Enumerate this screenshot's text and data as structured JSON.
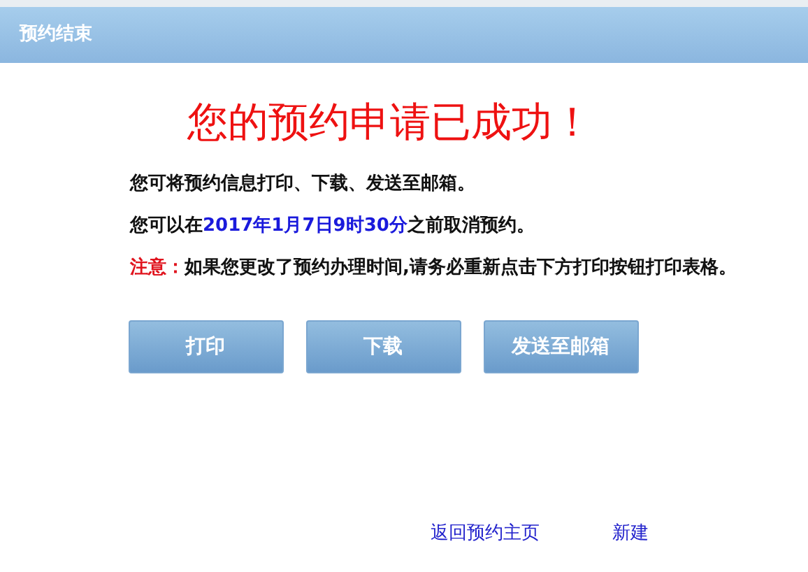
{
  "window": {
    "title": "预约结束"
  },
  "headline": "您的预约申请已成功！",
  "paragraphs": [
    {
      "parts": [
        {
          "kind": "plain",
          "text": "您可将预约信息打印、下载、发送至邮箱。"
        }
      ]
    },
    {
      "parts": [
        {
          "kind": "plain",
          "text": "您可以在"
        },
        {
          "kind": "highlight",
          "text": "2017年1月7日9时30分"
        },
        {
          "kind": "plain",
          "text": "之前取消预约。"
        }
      ]
    },
    {
      "parts": [
        {
          "kind": "warning",
          "text": "注意："
        },
        {
          "kind": "plain",
          "text": "如果您更改了预约办理时间,请务必重新点击下方打印按钮打印表格。"
        }
      ]
    }
  ],
  "buttons": [
    "打印",
    "下载",
    "发送至邮箱"
  ],
  "links": [
    "返回预约主页",
    "新建"
  ]
}
